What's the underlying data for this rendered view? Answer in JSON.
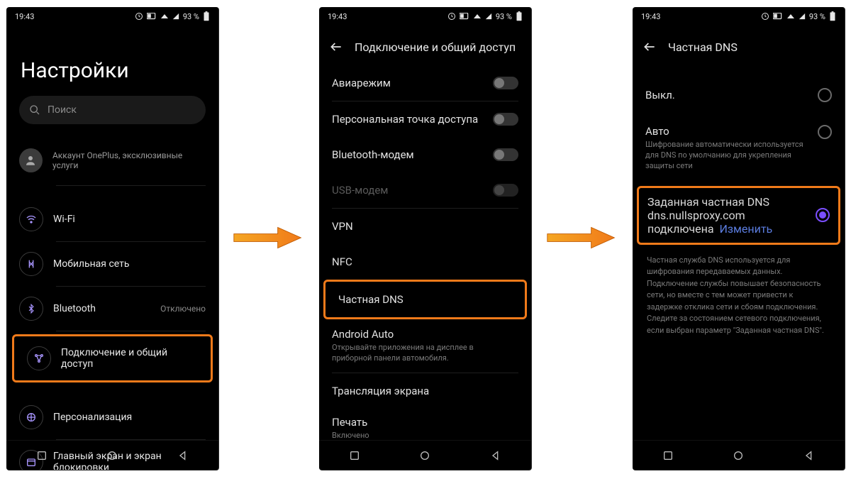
{
  "status": {
    "time": "19:43",
    "battery": "93 %"
  },
  "screen1": {
    "title": "Настройки",
    "search_placeholder": "Поиск",
    "account": "Аккаунт OnePlus, эксклюзивные услуги",
    "items": {
      "wifi": "Wi-Fi",
      "mobile": "Мобильная сеть",
      "bt": "Bluetooth",
      "bt_status": "Отключено",
      "share": "Подключение и общий доступ",
      "personal": "Персонализация",
      "home": "Главный экран и экран блокировки"
    }
  },
  "screen2": {
    "title": "Подключение и общий доступ",
    "airplane": "Авиарежим",
    "hotspot": "Персональная точка доступа",
    "bt_modem": "Bluetooth-модем",
    "usb_modem": "USB-модем",
    "vpn": "VPN",
    "nfc": "NFC",
    "dns": "Частная DNS",
    "auto": "Android Auto",
    "auto_sub": "Открывайте приложения на дисплее в приборной панели автомобиля.",
    "cast": "Трансляция экрана",
    "print": "Печать",
    "print_sub": "Включено"
  },
  "screen3": {
    "title": "Частная DNS",
    "off": "Выкл.",
    "auto": "Авто",
    "auto_sub": "Шифрование автоматически используется для DNS по умолчанию для укрепления защиты сети",
    "custom": "Заданная частная DNS",
    "custom_sub_pre": "dns.nullsproxy.com подключена",
    "custom_edit": "Изменить",
    "footer": "Частная служба DNS используется для шифрования передаваемых данных. Подключение службы повышает безопасность сети, но вместе с тем может привести к задержке отклика сети и сбоям подключения. Следите за состоянием сетевого подключения, если выбран параметр \"Заданная частная DNS\"."
  }
}
